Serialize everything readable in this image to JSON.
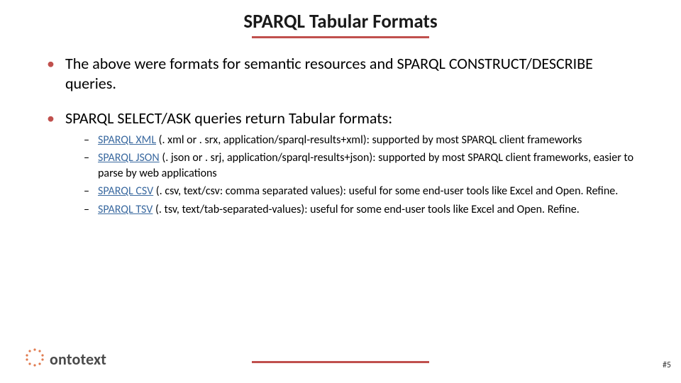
{
  "slide": {
    "title": "SPARQL Tabular Formats",
    "bullets": [
      {
        "text": "The above were formats for semantic resources and SPARQL CONSTRUCT/DESCRIBE queries."
      },
      {
        "text": "SPARQL SELECT/ASK queries return Tabular formats:",
        "sub": [
          {
            "link": "SPARQL XML",
            "rest": " (. xml or . srx, application/sparql-results+xml): supported by most SPARQL client frameworks"
          },
          {
            "link": "SPARQL JSON",
            "rest": " (. json or . srj, application/sparql-results+json): supported by most SPARQL client frameworks, easier to parse by web applications"
          },
          {
            "link": "SPARQL CSV",
            "rest": " (. csv, text/csv: comma separated values): useful for some end-user tools like Excel and Open. Refine."
          },
          {
            "link": "SPARQL TSV",
            "rest": " (. tsv, text/tab-separated-values): useful for some end-user tools like Excel and Open. Refine."
          }
        ]
      }
    ]
  },
  "footer": {
    "logo_text": "ontotext",
    "page_number": "#5"
  },
  "colors": {
    "accent": "#c0504d",
    "link": "#3b6aa0"
  }
}
